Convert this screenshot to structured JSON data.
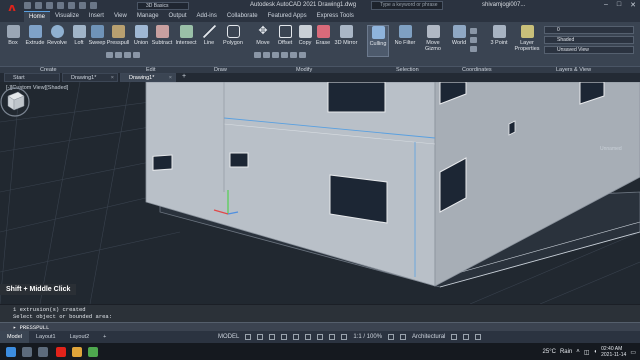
{
  "titlebar": {
    "app_letter": "A",
    "workspace": "3D Basics",
    "title": "Autodesk AutoCAD 2021   Drawing1.dwg",
    "search_placeholder": "Type a keyword or phrase",
    "user": "shivamjogi007...",
    "controls": [
      "–",
      "□",
      "✕"
    ]
  },
  "ribbon_tabs": [
    "Home",
    "Visualize",
    "Insert",
    "View",
    "Manage",
    "Output",
    "Add-ins",
    "Collaborate",
    "Featured Apps",
    "Express Tools"
  ],
  "ribbon": {
    "create_tools": [
      "Box",
      "Extrude",
      "Revolve",
      "Loft",
      "Sweep"
    ],
    "edit_tools": [
      "Presspull",
      "Union",
      "Subtract",
      "Intersect"
    ],
    "draw_tools": [
      "Line",
      "Polygon"
    ],
    "modify_tools": [
      "Move",
      "Offset",
      "Copy",
      "Erase",
      "3D Mirror"
    ],
    "selection_tools": [
      "Culling",
      "No Filter",
      "Move Gizmo"
    ],
    "coordinates_tools": [
      "World",
      "3 Point"
    ],
    "layers_tool": "Layer Properties",
    "visual_style": "Shaded",
    "view_name": "Unsaved View",
    "layer_value": "0"
  },
  "panel_labels": [
    "Create",
    "Edit",
    "Draw",
    "Modify",
    "Selection",
    "Coordinates",
    "Layers & View"
  ],
  "file_tabs": [
    {
      "label": "Start"
    },
    {
      "label": "Drawing1*"
    },
    {
      "label": "Drawing1*"
    }
  ],
  "viewport": {
    "label": "[-][Custom View][Shaded]",
    "unnamed": "Unnamed",
    "hint": "Shift + Middle Click"
  },
  "command": {
    "history": [
      "1 extrusion(s) created",
      "Select object or bounded area:"
    ],
    "prompt": "PRESSPULL"
  },
  "status": {
    "layout_tabs": [
      "Model",
      "Layout1",
      "Layout2"
    ],
    "mode": "MODEL",
    "scale": "1:1 / 100%",
    "workspace": "Architectural"
  },
  "taskbar": {
    "weather": "25°C",
    "condition": "Rain",
    "time": "02:40 AM",
    "date": "2021-11-14"
  },
  "colors": {
    "accent": "#5aa0e0",
    "building": "#b9c0c8",
    "logo": "#e2231a"
  }
}
